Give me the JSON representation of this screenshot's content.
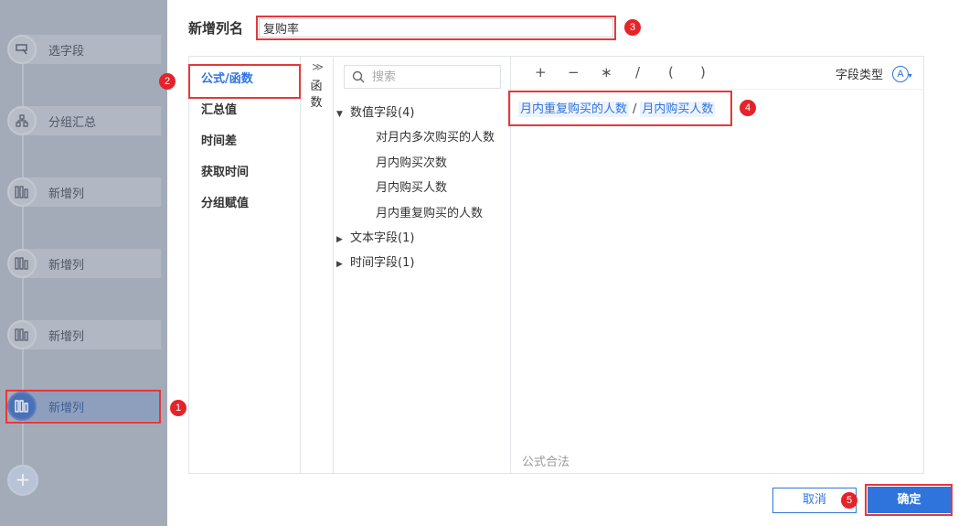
{
  "steps": [
    {
      "label": "选字段",
      "icon": "select-field-icon"
    },
    {
      "label": "分组汇总",
      "icon": "group-summary-icon"
    },
    {
      "label": "新增列",
      "icon": "add-column-icon"
    },
    {
      "label": "新增列",
      "icon": "add-column-icon"
    },
    {
      "label": "新增列",
      "icon": "add-column-icon"
    },
    {
      "label": "新增列",
      "icon": "add-column-icon",
      "active": true
    }
  ],
  "add_step_symbol": "+",
  "column_name": {
    "label": "新增列名",
    "value": "复购率"
  },
  "column_types": [
    "公式/函数",
    "汇总值",
    "时间差",
    "获取时间",
    "分组赋值"
  ],
  "functions_toggle": {
    "chevron": "≫",
    "label_line1": "函",
    "label_line2": "数"
  },
  "search": {
    "placeholder": "搜索"
  },
  "field_tree": {
    "numeric_group": {
      "label": "数值字段(4)",
      "expanded": true
    },
    "numeric_fields": [
      "对月内多次购买的人数",
      "月内购买次数",
      "月内购买人数",
      "月内重复购买的人数"
    ],
    "text_group": {
      "label": "文本字段(1)",
      "expanded": false
    },
    "time_group": {
      "label": "时间字段(1)",
      "expanded": false
    }
  },
  "operators": [
    "+",
    "−",
    "∗",
    "/",
    "(",
    ")"
  ],
  "field_type": {
    "label": "字段类型",
    "icon_letter": "A"
  },
  "formula": {
    "left_field": "月内重复购买的人数",
    "operator": "/",
    "right_field": "月内购买人数"
  },
  "formula_status": "公式合法",
  "buttons": {
    "cancel": "取消",
    "confirm": "确定"
  },
  "callouts": [
    "1",
    "2",
    "3",
    "4",
    "5"
  ],
  "colors": {
    "accent": "#2f74dd",
    "callout": "#e5232a",
    "overlay": "#a4abb8"
  }
}
